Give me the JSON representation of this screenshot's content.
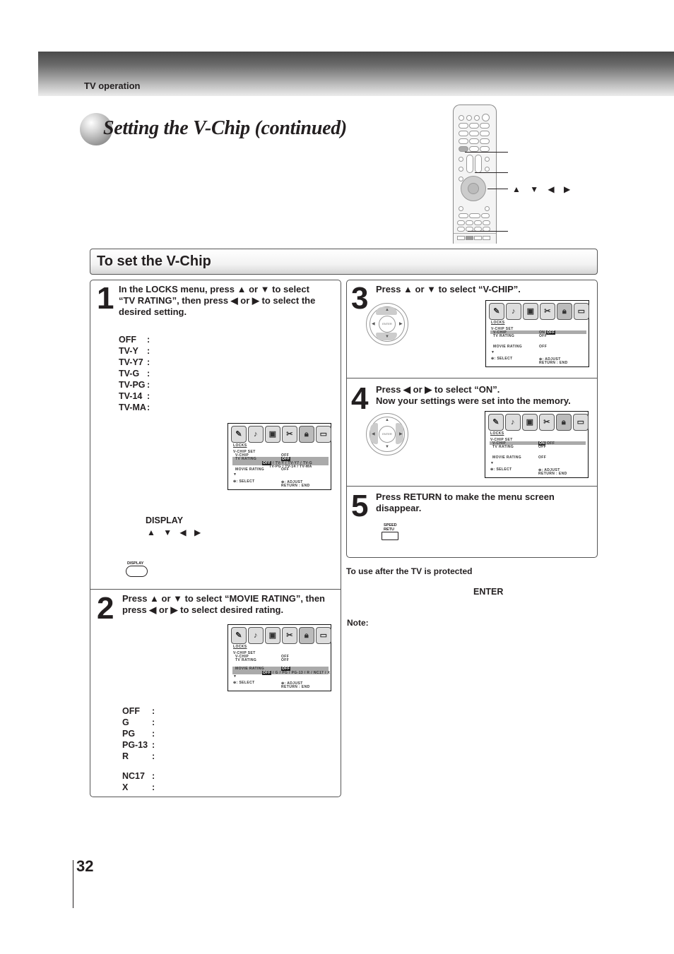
{
  "header": {
    "section": "TV operation",
    "title": "Setting the V-Chip (continued)"
  },
  "remote": {
    "callout_arrows": "▲ ▼ ◀ ▶"
  },
  "section": {
    "title": "To set the V-Chip"
  },
  "step1": {
    "number": "1",
    "instruction_line1": "In the LOCKS menu, press ▲ or ▼  to select",
    "instruction_line2": "“TV RATING”, then press  ◀ or ▶ to select the",
    "instruction_line3": "desired setting.",
    "ratings": [
      {
        "code": "OFF",
        "sep": ":"
      },
      {
        "code": "TV-Y",
        "sep": ":"
      },
      {
        "code": "TV-Y7",
        "sep": ":"
      },
      {
        "code": "TV-G",
        "sep": ":"
      },
      {
        "code": "TV-PG",
        "sep": ":"
      },
      {
        "code": "TV-14",
        "sep": ":"
      },
      {
        "code": "TV-MA",
        "sep": ":"
      }
    ],
    "display_label": "DISPLAY",
    "display_arrows": "▲ ▼ ◀ ▶",
    "display_key_label": "DISPLAY",
    "osd": {
      "menu": "LOCKS",
      "vchip_set": "V-CHIP SET",
      "vchip": "V-CHIP",
      "vchip_value": "OFF",
      "tv_rating": "TV RATING",
      "tv_rating_value": "OFF",
      "tv_rating_options_1_selected": "OFF",
      "tv_rating_options_1": " / TV-Y / TV-Y7 / TV-G",
      "tv_rating_options_2": "TV-PG / TV-14 / TV-MA",
      "movie_rating": "MOVIE RATING",
      "movie_rating_value": "OFF",
      "more": "▼",
      "select": ": SELECT",
      "adjust": ": ADJUST",
      "return_end": "RETURN : END"
    }
  },
  "step2": {
    "number": "2",
    "instruction_line1": "Press ▲ or ▼  to select “MOVIE RATING”, then",
    "instruction_line2": "press ◀ or ▶ to select desired rating.",
    "ratings": [
      {
        "code": "OFF",
        "sep": ":"
      },
      {
        "code": "G",
        "sep": ":"
      },
      {
        "code": "PG",
        "sep": ":"
      },
      {
        "code": "PG-13",
        "sep": ":"
      },
      {
        "code": "R",
        "sep": ":"
      },
      {
        "code": "NC17",
        "sep": ":"
      },
      {
        "code": "X",
        "sep": ":"
      }
    ],
    "osd": {
      "menu": "LOCKS",
      "vchip_set": "V-CHIP SET",
      "vchip": "V-CHIP",
      "vchip_value": "OFF",
      "tv_rating": "TV RATING",
      "tv_rating_value": "OFF",
      "movie_rating": "MOVIE RATING",
      "movie_rating_value": "OFF",
      "movie_options_selected": "OFF",
      "movie_options": " / G / PG / PG-13 / R / NC17 / X",
      "more": "▼",
      "select": ": SELECT",
      "adjust": ": ADJUST",
      "return_end": "RETURN : END"
    }
  },
  "step3": {
    "number": "3",
    "instruction": "Press ▲ or ▼  to select “V-CHIP”.",
    "dpad_label": "ENTER",
    "osd": {
      "menu": "LOCKS",
      "vchip_set": "V-CHIP SET",
      "vchip": "V-CHIP",
      "vchip_on": "ON",
      "vchip_off_selected": "OFF",
      "tv_rating": "TV RATING",
      "tv_rating_value": "OFF",
      "movie_rating": "MOVIE RATING",
      "movie_rating_value": "OFF",
      "more": "▼",
      "select": ": SELECT",
      "adjust": ": ADJUST",
      "return_end": "RETURN : END"
    }
  },
  "step4": {
    "number": "4",
    "instruction_line1": "Press ◀ or ▶ to select “ON”.",
    "instruction_line2": "Now your settings were set into the memory.",
    "dpad_label": "ENTER",
    "osd": {
      "menu": "LOCKS",
      "vchip_set": "V-CHIP SET",
      "vchip": "V-CHIP",
      "vchip_on_selected": "ON",
      "vchip_off": "OFF",
      "tv_rating": "TV RATING",
      "tv_rating_value": "OFF",
      "movie_rating": "MOVIE RATING",
      "movie_rating_value": "OFF",
      "more": "▼",
      "select": ": SELECT",
      "adjust": ": ADJUST",
      "return_end": "RETURN : END"
    }
  },
  "step5": {
    "number": "5",
    "instruction_line1": "Press RETURN to make the menu screen",
    "instruction_line2": "disappear.",
    "key_label_1": "SPEED",
    "key_label_2": "RETU"
  },
  "after_protected": {
    "heading": "To use after the TV is protected",
    "enter": "ENTER"
  },
  "note": {
    "heading": "Note:"
  },
  "footer": {
    "page_number": "32"
  }
}
